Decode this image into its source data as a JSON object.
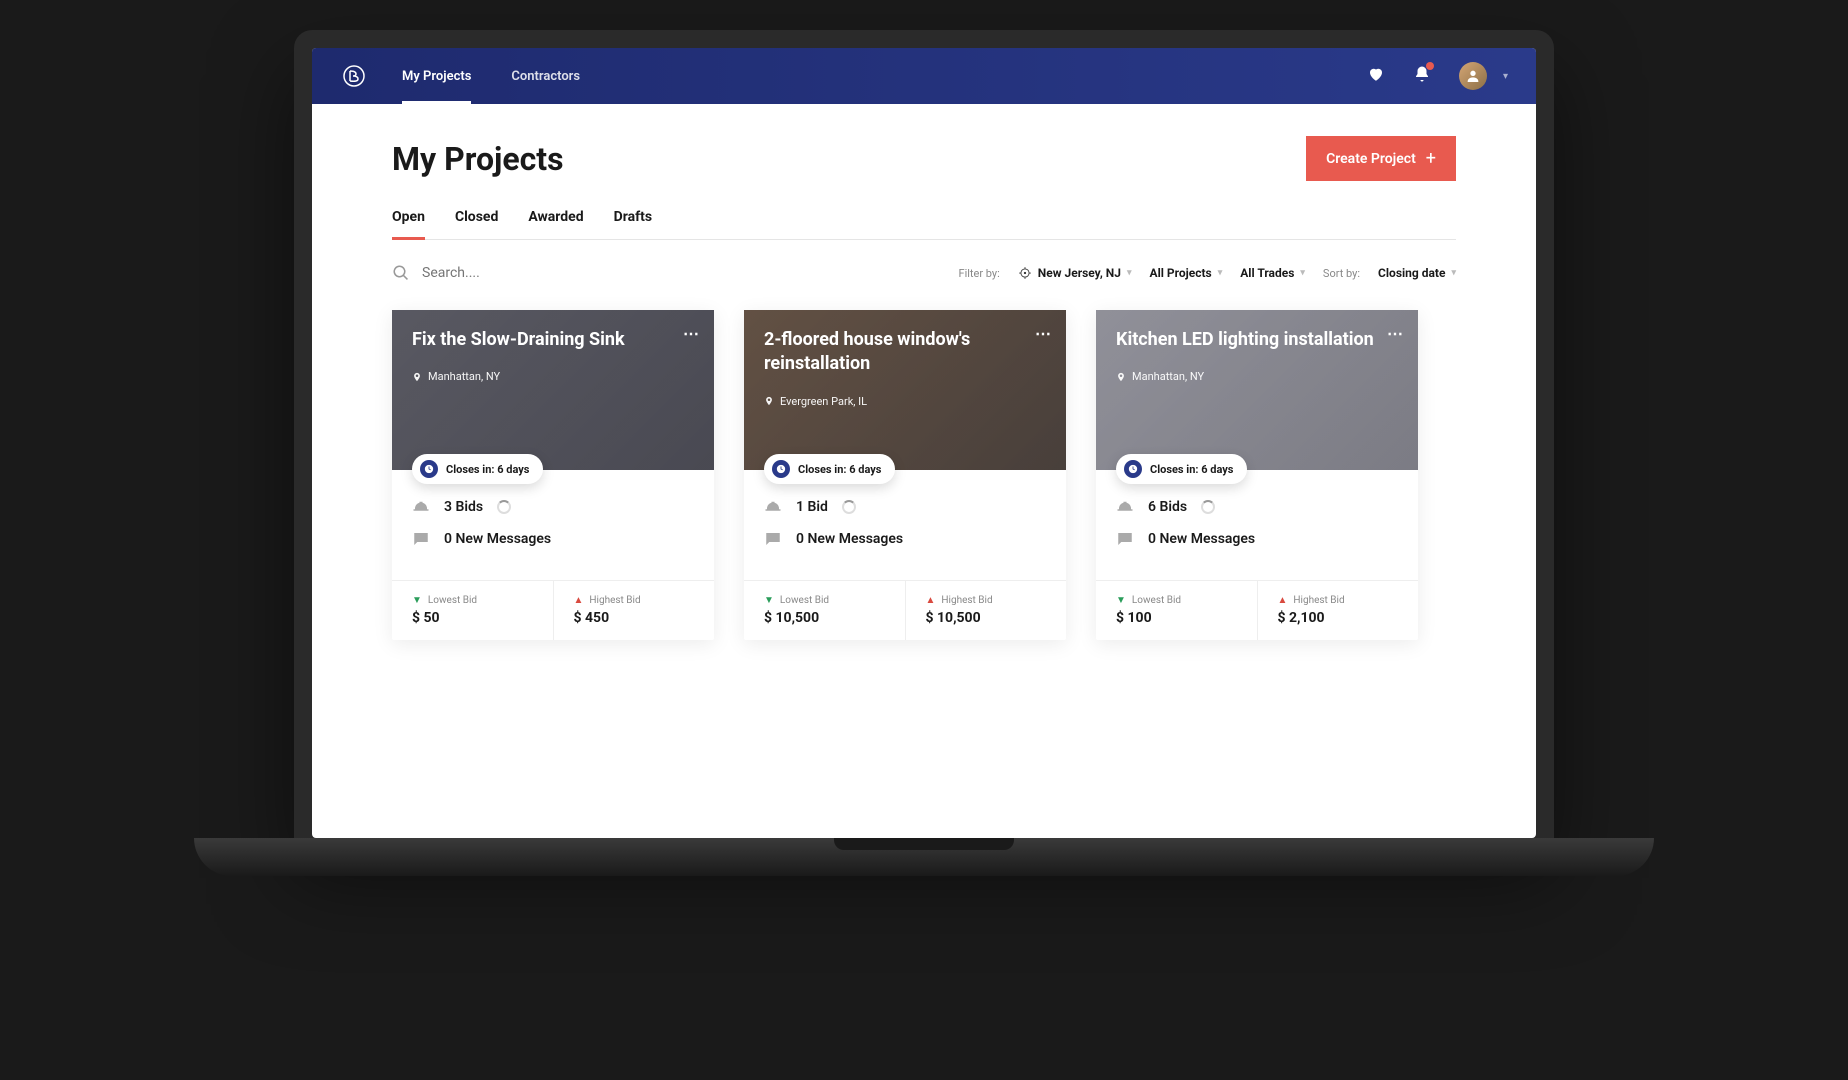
{
  "nav": {
    "myProjects": "My Projects",
    "contractors": "Contractors"
  },
  "page": {
    "title": "My Projects",
    "createBtn": "Create Project"
  },
  "tabs": {
    "open": "Open",
    "closed": "Closed",
    "awarded": "Awarded",
    "drafts": "Drafts"
  },
  "search": {
    "placeholder": "Search...."
  },
  "filters": {
    "filterBy": "Filter by:",
    "location": "New Jersey, NJ",
    "projects": "All Projects",
    "trades": "All Trades",
    "sortBy": "Sort by:",
    "sort": "Closing date"
  },
  "labels": {
    "closesIn": "Closes in: 6 days",
    "lowest": "Lowest Bid",
    "highest": "Highest Bid"
  },
  "cards": [
    {
      "title": "Fix the Slow-Draining Sink",
      "loc": "Manhattan, NY",
      "bids": "3 Bids",
      "msgs": "0 New Messages",
      "low": "$ 50",
      "high": "$ 450"
    },
    {
      "title": "2-floored house window's reinstallation",
      "loc": "Evergreen Park, IL",
      "bids": "1 Bid",
      "msgs": "0 New Messages",
      "low": "$ 10,500",
      "high": "$ 10,500"
    },
    {
      "title": "Kitchen LED lighting installation",
      "loc": "Manhattan, NY",
      "bids": "6 Bids",
      "msgs": "0 New Messages",
      "low": "$ 100",
      "high": "$ 2,100"
    }
  ]
}
